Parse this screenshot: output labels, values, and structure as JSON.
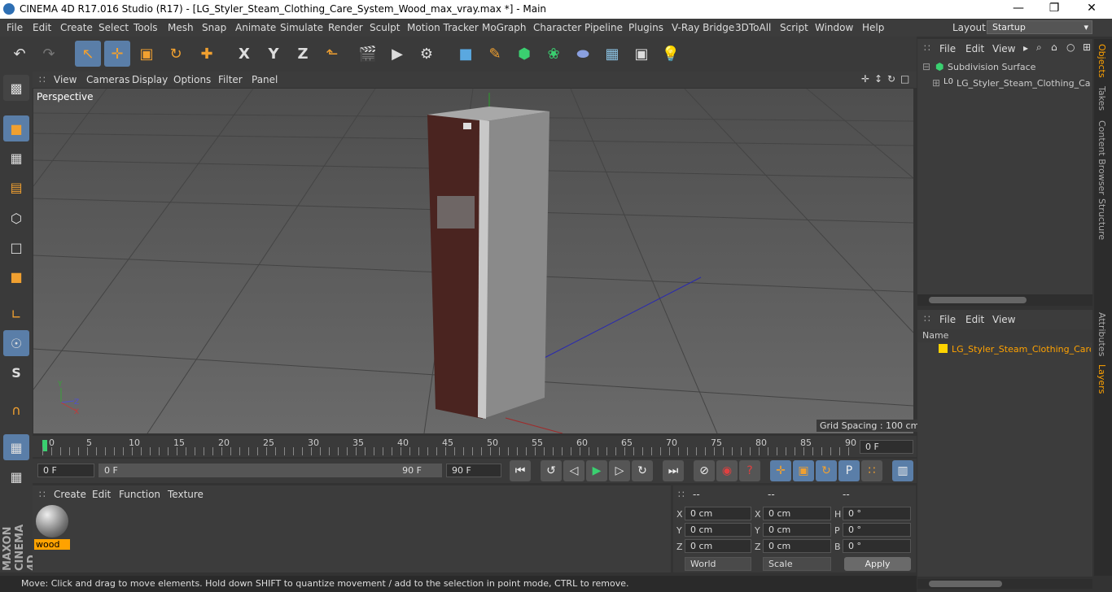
{
  "app": {
    "title": "CINEMA 4D R17.016 Studio (R17) - [LG_Styler_Steam_Clothing_Care_System_Wood_max_vray.max *] - Main"
  },
  "menu": [
    "File",
    "Edit",
    "Create",
    "Select",
    "Tools",
    "Mesh",
    "Snap",
    "Animate",
    "Simulate",
    "Render",
    "Sculpt",
    "Motion Tracker",
    "MoGraph",
    "Character",
    "Pipeline",
    "Plugins",
    "V-Ray Bridge",
    "3DToAll",
    "Script",
    "Window",
    "Help"
  ],
  "layout": {
    "label": "Layout:",
    "value": "Startup"
  },
  "toolbar_icons": [
    "undo-icon",
    "redo-icon",
    "live-selection-icon",
    "move-icon",
    "scale-icon",
    "rotate-icon",
    "recent-tool-icon",
    "x-axis-icon",
    "y-axis-icon",
    "z-axis-icon",
    "world-coord-icon",
    "render-view-icon",
    "render-picture-viewer-icon",
    "edit-render-settings-icon",
    "cube-icon",
    "pen-icon",
    "subdivision-icon",
    "cloner-icon",
    "deformer-icon",
    "floor-icon",
    "camera-icon",
    "light-icon"
  ],
  "toolbar_labels": {
    "x": "X",
    "y": "Y",
    "z": "Z"
  },
  "viewport": {
    "menu": [
      "View",
      "Cameras",
      "Display",
      "Options",
      "Filter",
      "Panel"
    ],
    "label": "Perspective",
    "grid": "Grid Spacing : 100 cm"
  },
  "timeline": {
    "ticks": [
      "0",
      "5",
      "10",
      "15",
      "20",
      "25",
      "30",
      "35",
      "40",
      "45",
      "50",
      "55",
      "60",
      "65",
      "70",
      "75",
      "80",
      "85",
      "90"
    ],
    "frame_field": "0 F",
    "start_field": "0 F",
    "range_start": "0 F",
    "range_end": "90 F",
    "end_field": "90 F"
  },
  "materials": {
    "menu": [
      "Create",
      "Edit",
      "Function",
      "Texture"
    ],
    "items": [
      {
        "name": "wood"
      }
    ]
  },
  "coords": {
    "headers": [
      "--",
      "--",
      "--"
    ],
    "rows": [
      {
        "a": "X",
        "av": "0 cm",
        "b": "X",
        "bv": "0 cm",
        "c": "H",
        "cv": "0 °"
      },
      {
        "a": "Y",
        "av": "0 cm",
        "b": "Y",
        "bv": "0 cm",
        "c": "P",
        "cv": "0 °"
      },
      {
        "a": "Z",
        "av": "0 cm",
        "b": "Z",
        "bv": "0 cm",
        "c": "B",
        "cv": "0 °"
      }
    ],
    "mode": "World",
    "type": "Scale",
    "apply": "Apply"
  },
  "objects": {
    "menu": [
      "File",
      "Edit",
      "View"
    ],
    "items": [
      "Subdivision Surface",
      "LG_Styler_Steam_Clothing_Care_S"
    ]
  },
  "layers": {
    "menu": [
      "File",
      "Edit",
      "View"
    ],
    "name_header": "Name",
    "items": [
      "LG_Styler_Steam_Clothing_Care_Sy"
    ]
  },
  "right_tabs": [
    "Objects",
    "Takes",
    "Content Browser",
    "Structure",
    "Attributes",
    "Layers"
  ],
  "status": "Move: Click and drag to move elements. Hold down SHIFT to quantize movement / add to the selection in point mode, CTRL to remove.",
  "brand": "MAXON CINEMA 4D",
  "colors": {
    "accent": "#5a7ea8",
    "highlight": "#ffa200",
    "bg": "#333333"
  }
}
